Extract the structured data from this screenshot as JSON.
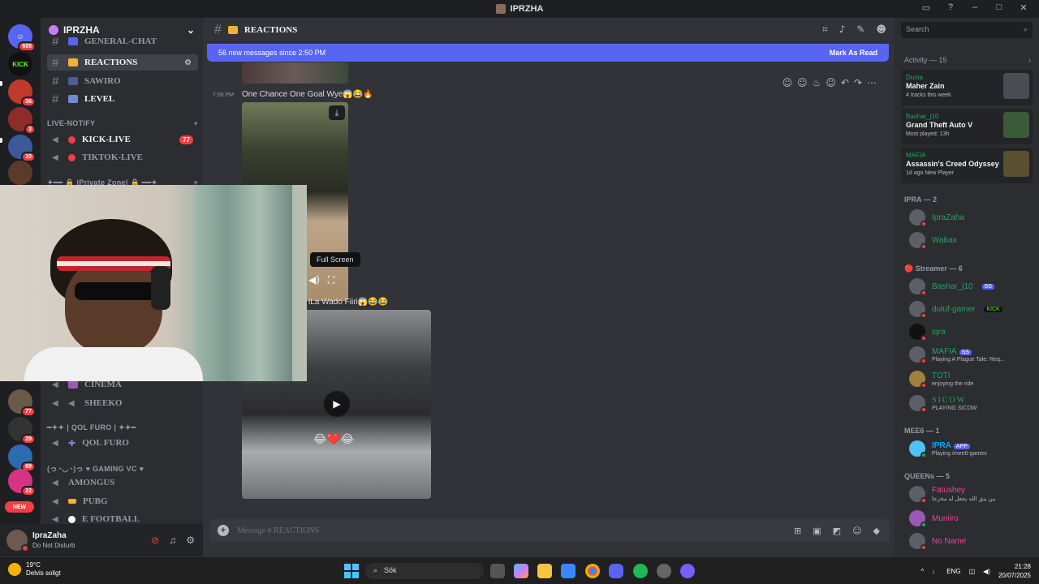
{
  "window": {
    "title": "IPRZHA",
    "controls": [
      "–",
      "□",
      "✕"
    ]
  },
  "servers": [
    {
      "label": "605",
      "color": "#5865f2",
      "badge": "605"
    },
    {
      "label": "KICK",
      "color": "#111",
      "badge": ""
    },
    {
      "label": "",
      "color": "#c0392b",
      "badge": "36"
    },
    {
      "label": "",
      "color": "#8e2b2b",
      "badge": "3"
    },
    {
      "label": "",
      "color": "#3b5998",
      "badge": "10"
    },
    {
      "label": "",
      "color": "#5c3a2a",
      "badge": ""
    },
    {
      "label": "",
      "color": "#6a5a4a",
      "badge": "77"
    },
    {
      "label": "",
      "color": "#333",
      "badge": "29"
    },
    {
      "label": "",
      "color": "#2b6cb0",
      "badge": "69"
    },
    {
      "label": "",
      "color": "#d63384",
      "badge": "22"
    },
    {
      "label": "NEW",
      "color": "#f23f43",
      "badge": ""
    }
  ],
  "guild": {
    "name": "IPRZHA",
    "chevron": "⌄"
  },
  "channels": [
    {
      "name": "GENERAL-CHAT",
      "type": "text"
    },
    {
      "name": "REACTIONS",
      "type": "text",
      "selected": true
    },
    {
      "name": "SAWIRO",
      "type": "text"
    },
    {
      "name": "LEVEL",
      "type": "text"
    }
  ],
  "category_live": {
    "name": "LIVE-NOTIFY",
    "plus": "+"
  },
  "live_channels": [
    {
      "name": "KICK-LIVE",
      "count": "77"
    },
    {
      "name": "TIKTOK-LIVE",
      "count": ""
    }
  ],
  "category_private": {
    "name": "✦━━ 🔒 |Private Zone| 🔒 ━━✦",
    "plus": "+"
  },
  "voice_channels": [
    {
      "name": "CINEMA"
    },
    {
      "name": "SHEEKO"
    }
  ],
  "category_qol": {
    "name": "━✦✦ | QOL FURO | ✦✦━"
  },
  "qol_channel": {
    "name": "QOL FURO"
  },
  "category_gaming": {
    "name": "(っ◔◡◔)っ ♥ GAMING VC ♥"
  },
  "gaming_channels": [
    {
      "name": "AMONGUS"
    },
    {
      "name": "PUBG"
    },
    {
      "name": "E FOOTBALL"
    }
  ],
  "user": {
    "name": "IpraZaha",
    "status": "Do Not Disturb"
  },
  "chat": {
    "channel_name": "REACTIONS",
    "new_messages": "56 new messages since 2:50 PM",
    "mark_read": "Mark As Read",
    "time": "7:58 PM",
    "message1": "One Chance One Goal Wye😱😂🔥",
    "tooltip": "Full Screen",
    "message2": "iLa Wado Fiiri😱😂😂",
    "video2_overlay": "😂❤️😂",
    "composer_placeholder": "Message #  REACTIONS"
  },
  "members": {
    "search_placeholder": "Search",
    "activity_title": "Activity — 15",
    "activities": [
      {
        "user": "Dunia",
        "title": "Maher Zain",
        "sub": "4 tracks this week"
      },
      {
        "user": "Bashar_j10",
        "title": "Grand Theft Auto V",
        "sub": "Most played: 13h"
      },
      {
        "user": "MAFIA",
        "title": "Assassin's Creed Odyssey",
        "sub": "1d ago  New Player"
      }
    ],
    "groups": [
      {
        "title": "IPRA — 2",
        "members": [
          {
            "name": "IpraZaha",
            "color": "#23a55a",
            "sub": "",
            "tag": ""
          },
          {
            "name": "Wabax",
            "color": "#23a55a",
            "sub": "",
            "tag": ""
          }
        ]
      },
      {
        "title": "🔴 Streamer — 6",
        "members": [
          {
            "name": "Bashar_j10",
            "color": "#23a55a",
            "sub": "",
            "tag": "SS"
          },
          {
            "name": "duluf-gamer",
            "color": "#23a55a",
            "sub": "",
            "tag": "KICK"
          },
          {
            "name": "iqra",
            "color": "#23a55a",
            "sub": "",
            "tag": ""
          },
          {
            "name": "MAFIA",
            "color": "#23a55a",
            "sub": "Playing A Plague Tale: Req...",
            "tag": "SS"
          },
          {
            "name": "TOTI",
            "color": "#23a55a",
            "sub": "enjoying the ride",
            "tag": ""
          },
          {
            "name": "SICOW",
            "color": "#23a55a",
            "sub": "PLAYING SICOW",
            "tag": ""
          }
        ]
      },
      {
        "title": "MEE6 — 1",
        "members": [
          {
            "name": "IPRA",
            "color": "#00a8fc",
            "sub": "Playing /mee6-games",
            "tag": "APP"
          }
        ]
      },
      {
        "title": "QUEENs — 5",
        "members": [
          {
            "name": "Fatushey",
            "color": "#eb459e",
            "sub": "من يتق الله يجعل له مخرجا",
            "tag": ""
          },
          {
            "name": "Muniiro",
            "color": "#eb459e",
            "sub": "",
            "tag": ""
          },
          {
            "name": "No Name",
            "color": "#eb459e",
            "sub": "",
            "tag": ""
          }
        ]
      }
    ]
  },
  "taskbar": {
    "weather_temp": "19°C",
    "weather_desc": "Delvis soligt",
    "search": "Sök",
    "lang": "ENG",
    "time": "21:28",
    "date": "20/07/2025"
  }
}
